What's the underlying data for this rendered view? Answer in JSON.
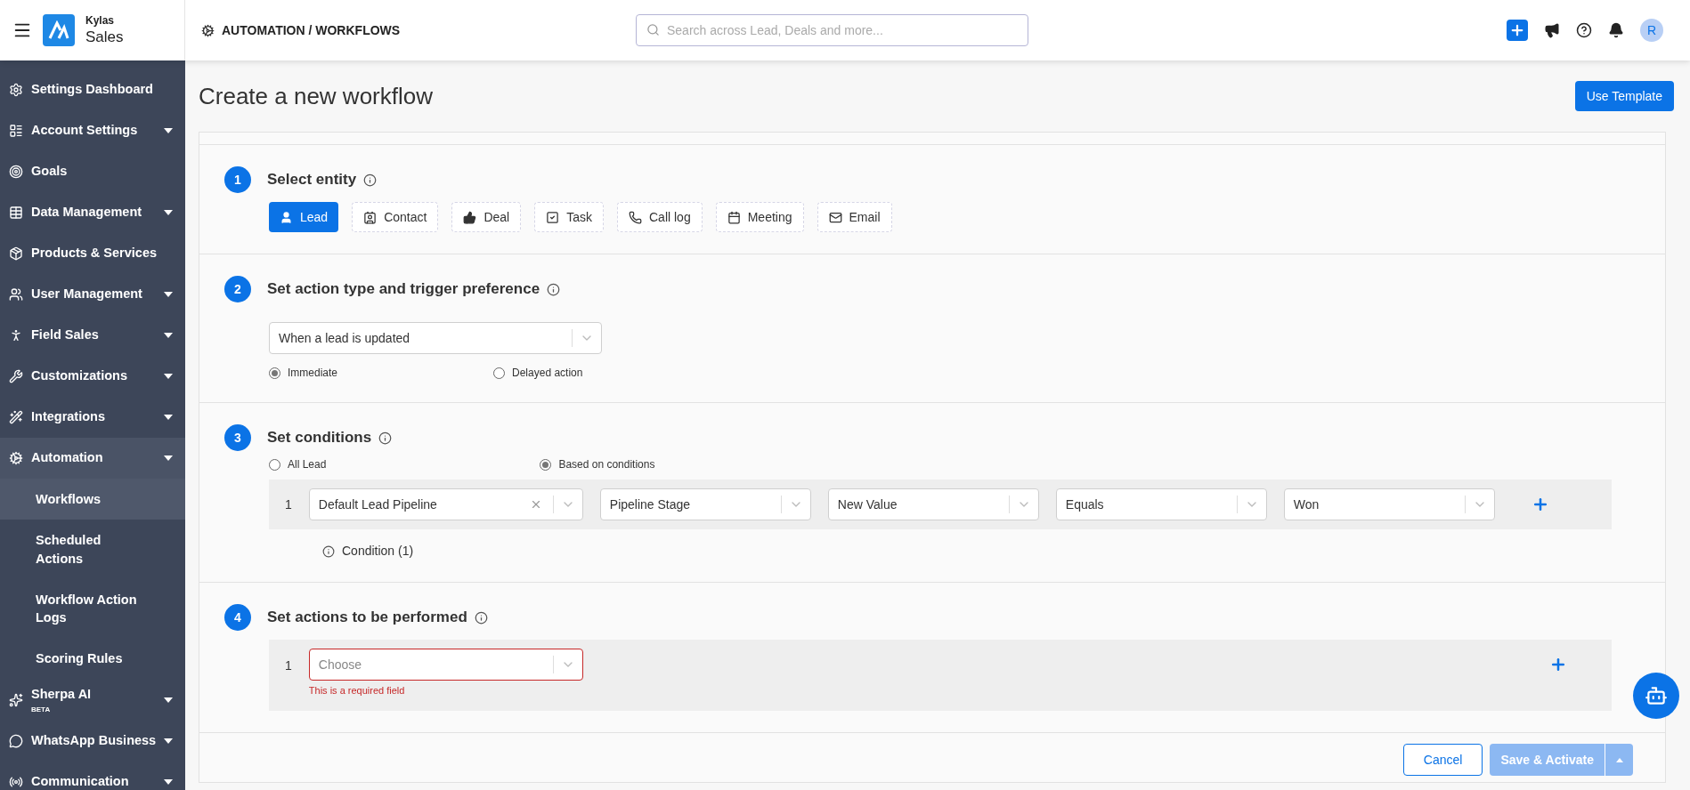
{
  "logo": {
    "brand": "Kylas",
    "product": "Sales"
  },
  "breadcrumb": "AUTOMATION / WORKFLOWS",
  "search": {
    "placeholder": "Search across Lead, Deals and more..."
  },
  "avatar": "R",
  "sidebar": {
    "items": [
      {
        "label": "Settings Dashboard",
        "has_submenu": false,
        "expanded": false
      },
      {
        "label": "Account Settings",
        "has_submenu": true,
        "expanded": false
      },
      {
        "label": "Goals",
        "has_submenu": false,
        "expanded": false
      },
      {
        "label": "Data Management",
        "has_submenu": true,
        "expanded": false
      },
      {
        "label": "Products & Services",
        "has_submenu": false,
        "expanded": false
      },
      {
        "label": "User Management",
        "has_submenu": true,
        "expanded": false
      },
      {
        "label": "Field Sales",
        "has_submenu": true,
        "expanded": false
      },
      {
        "label": "Customizations",
        "has_submenu": true,
        "expanded": false
      },
      {
        "label": "Integrations",
        "has_submenu": true,
        "expanded": false
      },
      {
        "label": "Automation",
        "has_submenu": true,
        "expanded": true,
        "children": [
          {
            "label": "Workflows",
            "selected": true
          },
          {
            "label": "Scheduled Actions",
            "selected": false
          },
          {
            "label": "Workflow Action Logs",
            "selected": false
          },
          {
            "label": "Scoring Rules",
            "selected": false
          }
        ]
      },
      {
        "label": "Sherpa AI",
        "badge": "BETA",
        "has_submenu": true,
        "expanded": false
      },
      {
        "label": "WhatsApp Business",
        "has_submenu": true,
        "expanded": false
      },
      {
        "label": "Communication",
        "has_submenu": true,
        "expanded": false
      }
    ]
  },
  "page_title": "Create a new workflow",
  "use_template_button": "Use Template",
  "steps": [
    {
      "number": "1",
      "title": "Select entity",
      "kind": "entity",
      "entities": [
        {
          "label": "Lead",
          "selected": true
        },
        {
          "label": "Contact",
          "selected": false
        },
        {
          "label": "Deal",
          "selected": false
        },
        {
          "label": "Task",
          "selected": false
        },
        {
          "label": "Call log",
          "selected": false
        },
        {
          "label": "Meeting",
          "selected": false
        },
        {
          "label": "Email",
          "selected": false
        }
      ]
    },
    {
      "number": "2",
      "title": "Set action type and trigger preference",
      "kind": "trigger",
      "select": "When a lead is updated",
      "radios": [
        {
          "label": "Immediate",
          "selected": true
        },
        {
          "label": "Delayed action",
          "selected": false
        }
      ]
    },
    {
      "number": "3",
      "title": "Set conditions",
      "kind": "conditions",
      "radios": [
        {
          "label": "All Lead",
          "selected": false
        },
        {
          "label": "Based on conditions",
          "selected": true
        }
      ],
      "rows": [
        {
          "number": "1",
          "fields": [
            {
              "value": "Default Lead Pipeline",
              "clearable": true
            },
            {
              "value": "Pipeline Stage",
              "clearable": false
            },
            {
              "value": "New Value",
              "clearable": false
            },
            {
              "value": "Equals",
              "clearable": false
            },
            {
              "value": "Won",
              "clearable": false
            }
          ]
        }
      ],
      "summary": "Condition (1)"
    },
    {
      "number": "4",
      "title": "Set actions to be performed",
      "kind": "actions",
      "rows": [
        {
          "number": "1",
          "placeholder": "Choose",
          "invalid": true,
          "error": "This is a required field"
        }
      ]
    }
  ],
  "footer": {
    "cancel": "Cancel",
    "save": "Save & Activate",
    "save_disabled": true
  }
}
